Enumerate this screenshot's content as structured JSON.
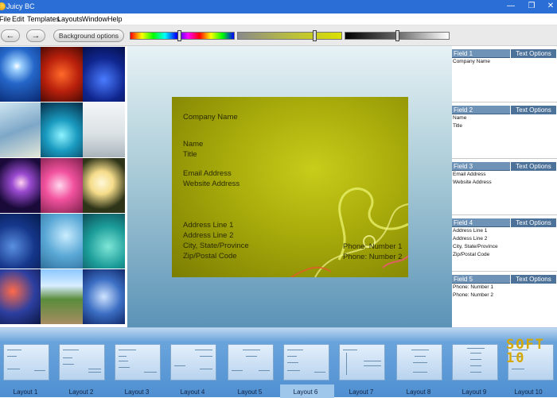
{
  "window": {
    "title": "Juicy BC",
    "minimize": "—",
    "maximize": "❐",
    "close": "✕"
  },
  "menu": [
    "File",
    "Edit",
    "Templates",
    "Layouts",
    "Window",
    "Help"
  ],
  "toolbar": {
    "back": "←",
    "forward": "→",
    "background_options": "Background options"
  },
  "sliders": {
    "hue_level": 0.47,
    "tint_level": 0.75,
    "shade_level": 0.5
  },
  "gallery": {
    "columns": 3,
    "rows": 5,
    "selected": null
  },
  "card": {
    "company": "Company Name",
    "name": "Name",
    "title": "Title",
    "email": "Email Address",
    "website": "Website Address",
    "address1": "Address Line 1",
    "address2": "Address Line 2",
    "city": "City, State/Province",
    "zip": "Zip/Postal Code",
    "phone1": "Phone: Number 1",
    "phone2": "Phone: Number 2"
  },
  "fields": [
    {
      "label": "Field 1",
      "options": "Text Options",
      "lines": [
        "Company Name"
      ]
    },
    {
      "label": "Field 2",
      "options": "Text Options",
      "lines": [
        "Name",
        "Title"
      ]
    },
    {
      "label": "Field 3",
      "options": "Text Options",
      "lines": [
        "Email Address",
        "Website Address"
      ]
    },
    {
      "label": "Field 4",
      "options": "Text Options",
      "lines": [
        "Address Line 1",
        "Address Line 2",
        "City, State/Province",
        "Zip/Postal Code"
      ]
    },
    {
      "label": "Field 5",
      "options": "Text Options",
      "lines": [
        "Phone: Number 1",
        "Phone: Number 2"
      ]
    }
  ],
  "layouts": [
    "Layout 1",
    "Layout 2",
    "Layout 3",
    "Layout 4",
    "Layout 5",
    "Layout 6",
    "Layout 7",
    "Layout 8",
    "Layout 9",
    "Layout 10"
  ],
  "selected_layout": "Layout 6",
  "watermark": "SOFT10"
}
